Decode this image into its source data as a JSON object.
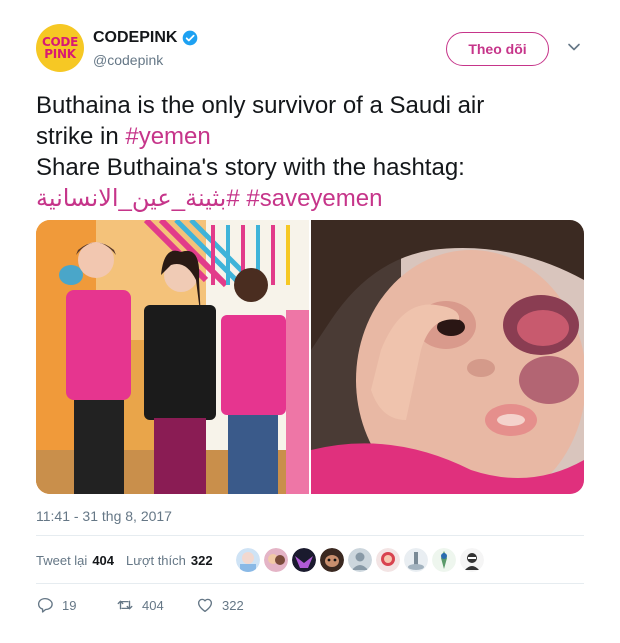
{
  "author": {
    "avatar_line1": "CODE",
    "avatar_line2": "PINK",
    "display_name": "CODEPINK",
    "handle": "@codepink",
    "verified_icon": "verified-badge-icon"
  },
  "follow_label": "Theo dõi",
  "tweet": {
    "line1": "Buthaina is the only survivor of a Saudi air",
    "line2_text": "strike in ",
    "line2_tag": "#yemen",
    "line3": "Share Buthaina's story with the hashtag:",
    "tag_arabic": "#بثينة_عين_الانسانية",
    "tag_save": "#saveyemen"
  },
  "timestamp": "11:41 - 31 thg 8, 2017",
  "stats": {
    "retweets_label": "Tweet lại",
    "retweets_count": "404",
    "likes_label": "Lượt thích",
    "likes_count": "322"
  },
  "actions": {
    "reply_count": "19",
    "retweet_count": "404",
    "like_count": "322"
  },
  "colors": {
    "accent": "#c6358a",
    "avatar_bg": "#f6c824",
    "verified": "#1da1f2",
    "muted": "#657786",
    "divider": "#e6ecf0"
  }
}
